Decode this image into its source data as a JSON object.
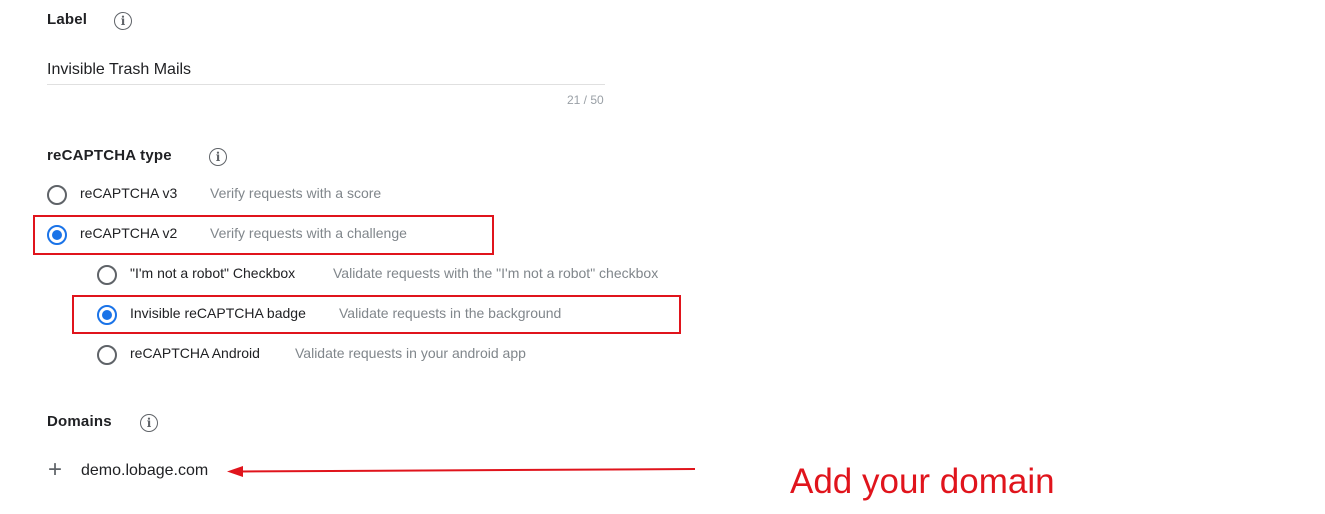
{
  "label_section": {
    "title": "Label",
    "value": "Invisible Trash Mails",
    "counter": "21 / 50"
  },
  "type_section": {
    "title": "reCAPTCHA type",
    "options": [
      {
        "label": "reCAPTCHA v3",
        "desc": "Verify requests with a score",
        "selected": false
      },
      {
        "label": "reCAPTCHA v2",
        "desc": "Verify requests with a challenge",
        "selected": true
      }
    ],
    "suboptions": [
      {
        "label": "\"I'm not a robot\" Checkbox",
        "desc": "Validate requests with the \"I'm not a robot\" checkbox",
        "selected": false
      },
      {
        "label": "Invisible reCAPTCHA badge",
        "desc": "Validate requests in the background",
        "selected": true
      },
      {
        "label": "reCAPTCHA Android",
        "desc": "Validate requests in your android app",
        "selected": false
      }
    ]
  },
  "domains_section": {
    "title": "Domains",
    "add_icon": "plus-icon",
    "domain": "demo.lobage.com"
  },
  "annotation": {
    "text": "Add your domain",
    "color": "#e0141c"
  },
  "colors": {
    "accent": "#1a73e8",
    "highlight": "#e0141c"
  }
}
